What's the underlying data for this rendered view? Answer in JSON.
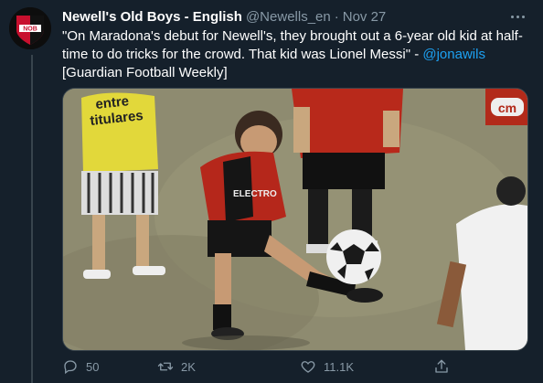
{
  "tweet": {
    "author_name": "Newell's Old Boys - English",
    "handle": "@Newells_en",
    "separator": "·",
    "date": "Nov 27",
    "avatar_text": "NOB",
    "text_before_mention": "\"On Maradona's debut for Newell's, they brought out a 6-year old kid at half-time to do tricks for the crowd. That kid was Lionel Messi\" - ",
    "mention": "@jonawils",
    "text_after_mention": "[Guardian Football Weekly]"
  },
  "media": {
    "shirt_sign_text_1": "entre",
    "shirt_sign_text_2": "titulares",
    "jersey_text": "ELECTRO",
    "banner_text": "cm"
  },
  "actions": {
    "reply_count": "50",
    "retweet_count": "2K",
    "like_count": "11.1K"
  },
  "colors": {
    "background": "#15202b",
    "secondary_text": "#8899a6",
    "link": "#1da1f2",
    "divider": "#38444d"
  },
  "icons": [
    "reply-icon",
    "retweet-icon",
    "heart-icon",
    "share-icon",
    "more-icon"
  ]
}
